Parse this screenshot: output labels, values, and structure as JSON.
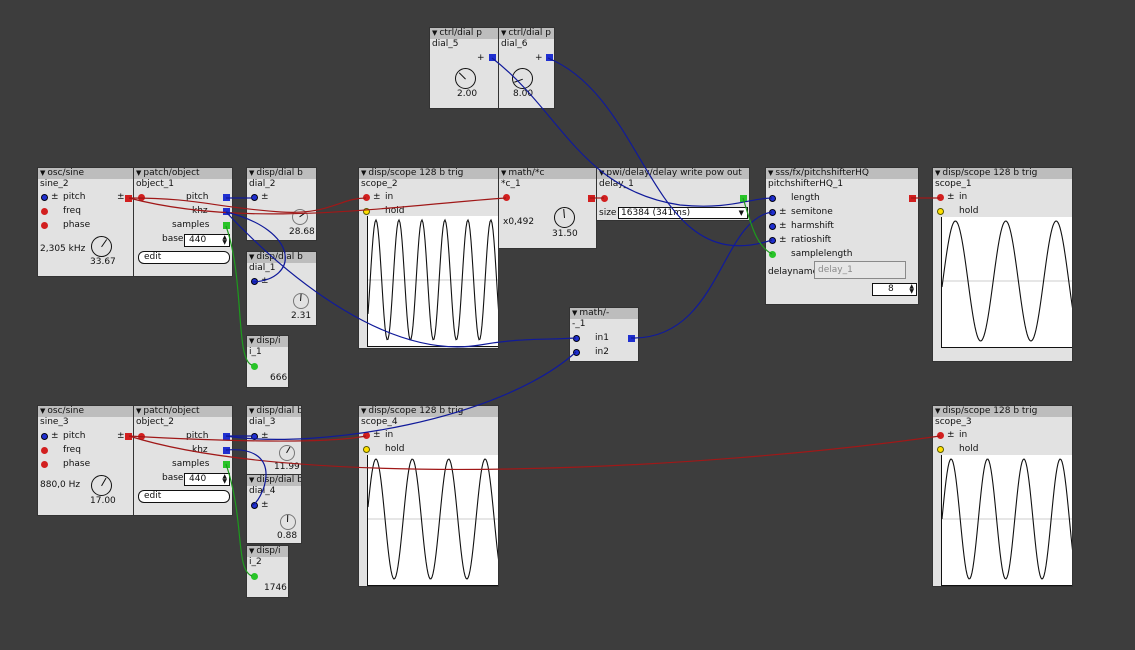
{
  "colors": {
    "background": "#3d3d3d",
    "box": "#e2e2e2",
    "header": "#bdbdbd",
    "wire_red": "#a01818",
    "wire_blue": "#101a9a",
    "wire_green": "#1d9a1d"
  },
  "objects": {
    "dial5": {
      "type": "ctrl/dial p",
      "name": "dial_5",
      "pm": "+",
      "value": "2.00"
    },
    "dial6": {
      "type": "ctrl/dial p",
      "name": "dial_6",
      "pm": "+",
      "value": "8.00"
    },
    "sine2": {
      "type": "osc/sine",
      "name": "sine_2",
      "pm": "±",
      "pitch": "pitch",
      "freq": "freq",
      "phase": "phase",
      "readout": "2,305 kHz",
      "value": "33.67"
    },
    "patch1": {
      "type": "patch/object",
      "name": "object_1",
      "pm": "±",
      "pitch": "pitch",
      "khz": "khz",
      "samples": "samples",
      "base": "base",
      "base_value": "440",
      "edit": "edit"
    },
    "dial2": {
      "type": "disp/dial b",
      "name": "dial_2",
      "pm": "±",
      "value": "28.68"
    },
    "dial1": {
      "type": "disp/dial b",
      "name": "dial_1",
      "pm": "±",
      "value": "2.31"
    },
    "i1": {
      "type": "disp/i",
      "name": "i_1",
      "value": "666"
    },
    "scope2": {
      "type": "disp/scope 128 b trig",
      "name": "scope_2",
      "pm": "±",
      "in": "in",
      "hold": "hold"
    },
    "mathc": {
      "type": "math/*c",
      "name": "*c_1",
      "factor": "x0,492",
      "value": "31.50"
    },
    "delay": {
      "type": "pwi/delay/delay write pow out",
      "name": "delay_1",
      "size_label": "size",
      "size_value": "16384 (341ms)"
    },
    "pitchshifter": {
      "type": "sss/fx/pitchshifterHQ",
      "name": "pitchshifterHQ_1",
      "pm": "±",
      "length": "length",
      "semitone": "semitone",
      "harmshift": "harmshift",
      "ratioshift": "ratioshift",
      "samplelength": "samplelength",
      "delayname_label": "delayname",
      "delayname_value": "delay_1",
      "num_value": "8"
    },
    "scope1": {
      "type": "disp/scope 128 b trig",
      "name": "scope_1",
      "pm": "±",
      "in": "in",
      "hold": "hold"
    },
    "minus": {
      "type": "math/-",
      "name": "-_1",
      "in1": "in1",
      "in2": "in2"
    },
    "sine3": {
      "type": "osc/sine",
      "name": "sine_3",
      "pm": "±",
      "pitch": "pitch",
      "freq": "freq",
      "phase": "phase",
      "readout": "880,0 Hz",
      "value": "17.00"
    },
    "patch2": {
      "type": "patch/object",
      "name": "object_2",
      "pm": "±",
      "pitch": "pitch",
      "khz": "khz",
      "samples": "samples",
      "base": "base",
      "base_value": "440",
      "edit": "edit"
    },
    "dial3": {
      "type": "disp/dial b",
      "name": "dial_3",
      "pm": "±",
      "value": "11.99"
    },
    "dial4": {
      "type": "disp/dial b",
      "name": "dial_4",
      "pm": "±",
      "value": "0.88"
    },
    "i2": {
      "type": "disp/i",
      "name": "i_2",
      "value": "1746"
    },
    "scope4": {
      "type": "disp/scope 128 b trig",
      "name": "scope_4",
      "pm": "±",
      "in": "in",
      "hold": "hold"
    },
    "scope3": {
      "type": "disp/scope 128 b trig",
      "name": "scope_3",
      "pm": "±",
      "in": "in",
      "hold": "hold"
    }
  },
  "scope_waves": {
    "scope_2_cycles": 5.7,
    "scope_1_cycles": 2.6,
    "scope_4_cycles": 3.6,
    "scope_3_cycles": 3.6
  }
}
